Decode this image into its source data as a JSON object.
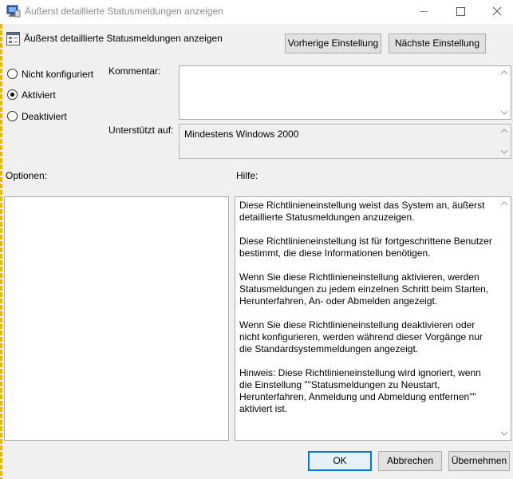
{
  "window": {
    "title": "Äußerst detaillierte Statusmeldungen anzeigen"
  },
  "setting": {
    "title": "Äußerst detaillierte Statusmeldungen anzeigen"
  },
  "nav": {
    "prev_label": "Vorherige Einstellung",
    "next_label": "Nächste Einstellung"
  },
  "state": {
    "options": [
      {
        "label": "Nicht konfiguriert",
        "selected": false
      },
      {
        "label": "Aktiviert",
        "selected": true
      },
      {
        "label": "Deaktiviert",
        "selected": false
      }
    ]
  },
  "comment": {
    "label": "Kommentar:",
    "value": ""
  },
  "supported": {
    "label": "Unterstützt auf:",
    "value": "Mindestens Windows 2000"
  },
  "options_panel": {
    "label": "Optionen:"
  },
  "help_panel": {
    "label": "Hilfe:",
    "paragraphs": [
      "Diese Richtlinieneinstellung weist das System an, äußerst detaillierte Statusmeldungen anzuzeigen.",
      "Diese Richtlinieneinstellung ist für fortgeschrittene Benutzer bestimmt, die diese Informationen benötigen.",
      "Wenn Sie diese Richtlinieneinstellung aktivieren, werden Statusmeldungen zu jedem einzelnen Schritt beim Starten, Herunterfahren, An- oder Abmelden angezeigt.",
      "Wenn Sie diese Richtlinieneinstellung deaktivieren oder nicht konfigurieren, werden während dieser Vorgänge nur die Standardsystemmeldungen angezeigt.",
      "Hinweis: Diese Richtlinieneinstellung wird ignoriert, wenn die Einstellung \"\"Statusmeldungen zu Neustart, Herunterfahren, Anmeldung und Abmeldung entfernen\"\" aktiviert ist."
    ]
  },
  "footer": {
    "ok_label": "OK",
    "cancel_label": "Abbrechen",
    "apply_label": "Übernehmen"
  },
  "colors": {
    "window_bg": "#f0f0f0",
    "accent": "#0078d7",
    "titlebar_text": "#8a8a8a"
  }
}
